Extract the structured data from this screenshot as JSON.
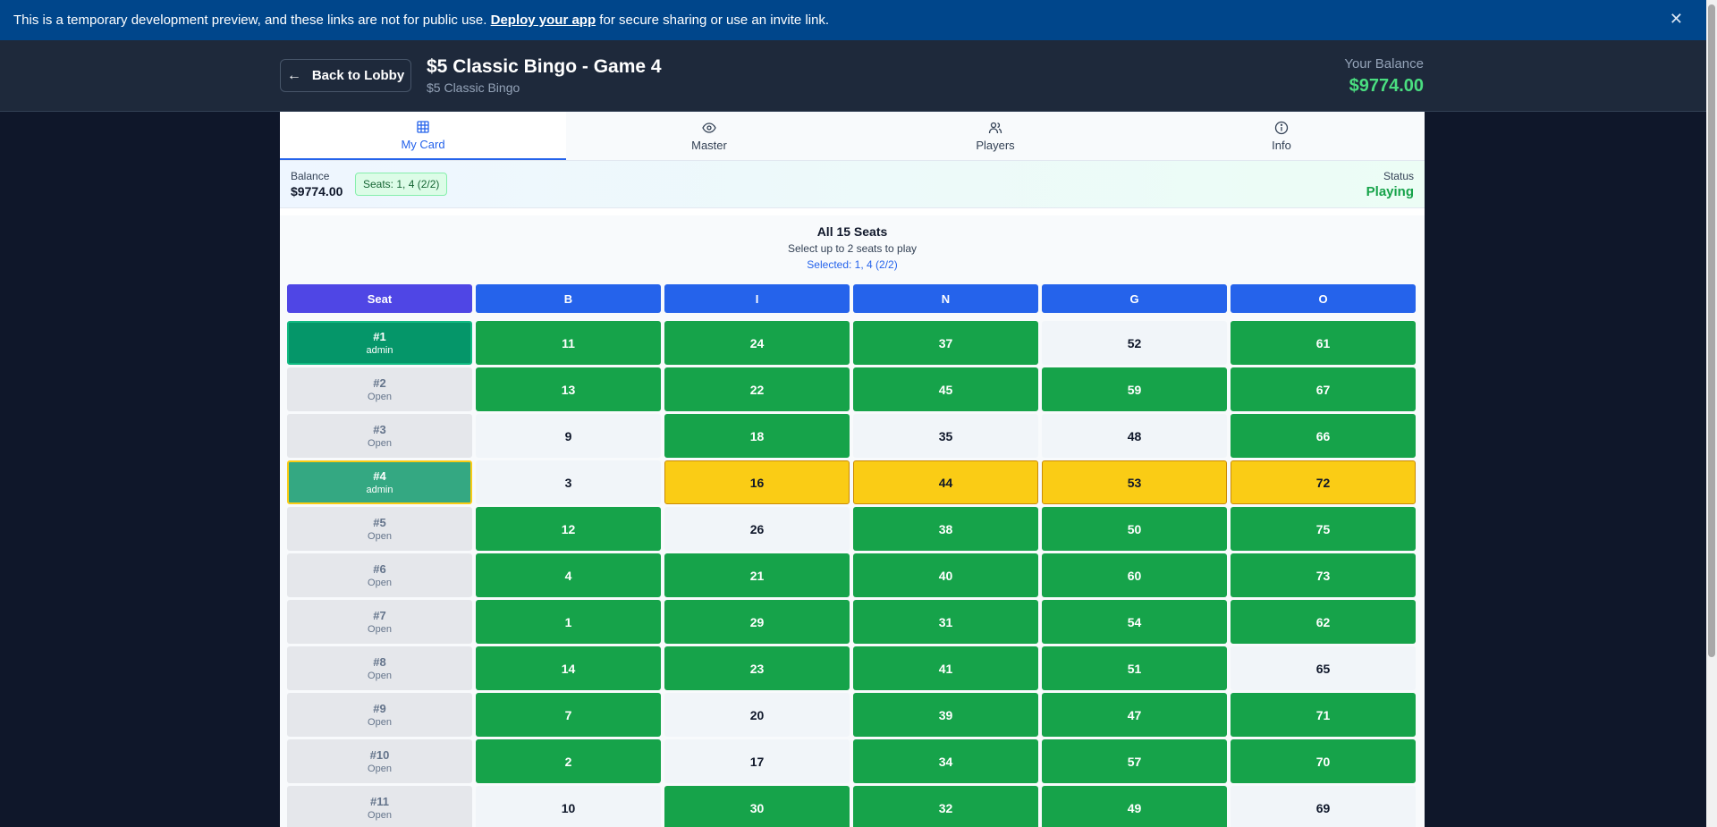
{
  "banner": {
    "text_before": "This is a temporary development preview, and these links are not for public use. ",
    "link": "Deploy your app",
    "text_after": " for secure sharing or use an invite link.",
    "close": "✕"
  },
  "header": {
    "back_label": "Back to Lobby",
    "title": "$5 Classic Bingo - Game 4",
    "subtitle": "$5 Classic Bingo",
    "balance_label": "Your Balance",
    "balance_value": "$9774.00"
  },
  "tabs": [
    {
      "label": "My Card",
      "icon": "grid-icon"
    },
    {
      "label": "Master",
      "icon": "eye-icon"
    },
    {
      "label": "Players",
      "icon": "users-icon"
    },
    {
      "label": "Info",
      "icon": "info-icon"
    }
  ],
  "status": {
    "balance_label": "Balance",
    "balance_value": "$9774.00",
    "seats_badge": "Seats: 1, 4 (2/2)",
    "status_label": "Status",
    "status_value": "Playing"
  },
  "seats": {
    "title": "All 15 Seats",
    "subtitle": "Select up to 2 seats to play",
    "selected": "Selected: 1, 4 (2/2)",
    "headers": [
      "Seat",
      "B",
      "I",
      "N",
      "G",
      "O"
    ],
    "rows": [
      {
        "seat": "#1",
        "owner": "admin",
        "state": "mine",
        "values": [
          "11",
          "24",
          "37",
          "52",
          "61"
        ],
        "styles": [
          "g",
          "g",
          "g",
          "n",
          "g"
        ]
      },
      {
        "seat": "#2",
        "owner": "Open",
        "state": "open",
        "values": [
          "13",
          "22",
          "45",
          "59",
          "67"
        ],
        "styles": [
          "g",
          "g",
          "g",
          "g",
          "g"
        ]
      },
      {
        "seat": "#3",
        "owner": "Open",
        "state": "open",
        "values": [
          "9",
          "18",
          "35",
          "48",
          "66"
        ],
        "styles": [
          "n",
          "g",
          "n",
          "n",
          "g"
        ]
      },
      {
        "seat": "#4",
        "owner": "admin",
        "state": "mine-alt",
        "values": [
          "3",
          "16",
          "44",
          "53",
          "72"
        ],
        "styles": [
          "n",
          "y",
          "y",
          "y",
          "y"
        ]
      },
      {
        "seat": "#5",
        "owner": "Open",
        "state": "open",
        "values": [
          "12",
          "26",
          "38",
          "50",
          "75"
        ],
        "styles": [
          "g",
          "n",
          "g",
          "g",
          "g"
        ]
      },
      {
        "seat": "#6",
        "owner": "Open",
        "state": "open",
        "values": [
          "4",
          "21",
          "40",
          "60",
          "73"
        ],
        "styles": [
          "g",
          "g",
          "g",
          "g",
          "g"
        ]
      },
      {
        "seat": "#7",
        "owner": "Open",
        "state": "open",
        "values": [
          "1",
          "29",
          "31",
          "54",
          "62"
        ],
        "styles": [
          "g",
          "g",
          "g",
          "g",
          "g"
        ]
      },
      {
        "seat": "#8",
        "owner": "Open",
        "state": "open",
        "values": [
          "14",
          "23",
          "41",
          "51",
          "65"
        ],
        "styles": [
          "g",
          "g",
          "g",
          "g",
          "n"
        ]
      },
      {
        "seat": "#9",
        "owner": "Open",
        "state": "open",
        "values": [
          "7",
          "20",
          "39",
          "47",
          "71"
        ],
        "styles": [
          "g",
          "n",
          "g",
          "g",
          "g"
        ]
      },
      {
        "seat": "#10",
        "owner": "Open",
        "state": "open",
        "values": [
          "2",
          "17",
          "34",
          "57",
          "70"
        ],
        "styles": [
          "g",
          "n",
          "g",
          "g",
          "g"
        ]
      },
      {
        "seat": "#11",
        "owner": "Open",
        "state": "open",
        "values": [
          "10",
          "30",
          "32",
          "49",
          "69"
        ],
        "styles": [
          "n",
          "g",
          "g",
          "g",
          "n"
        ]
      }
    ]
  },
  "colors": {
    "banner": "#00468b",
    "accent": "#2563eb",
    "marked": "#16a34a",
    "highlight": "#facc15",
    "balance": "#4ade80"
  }
}
